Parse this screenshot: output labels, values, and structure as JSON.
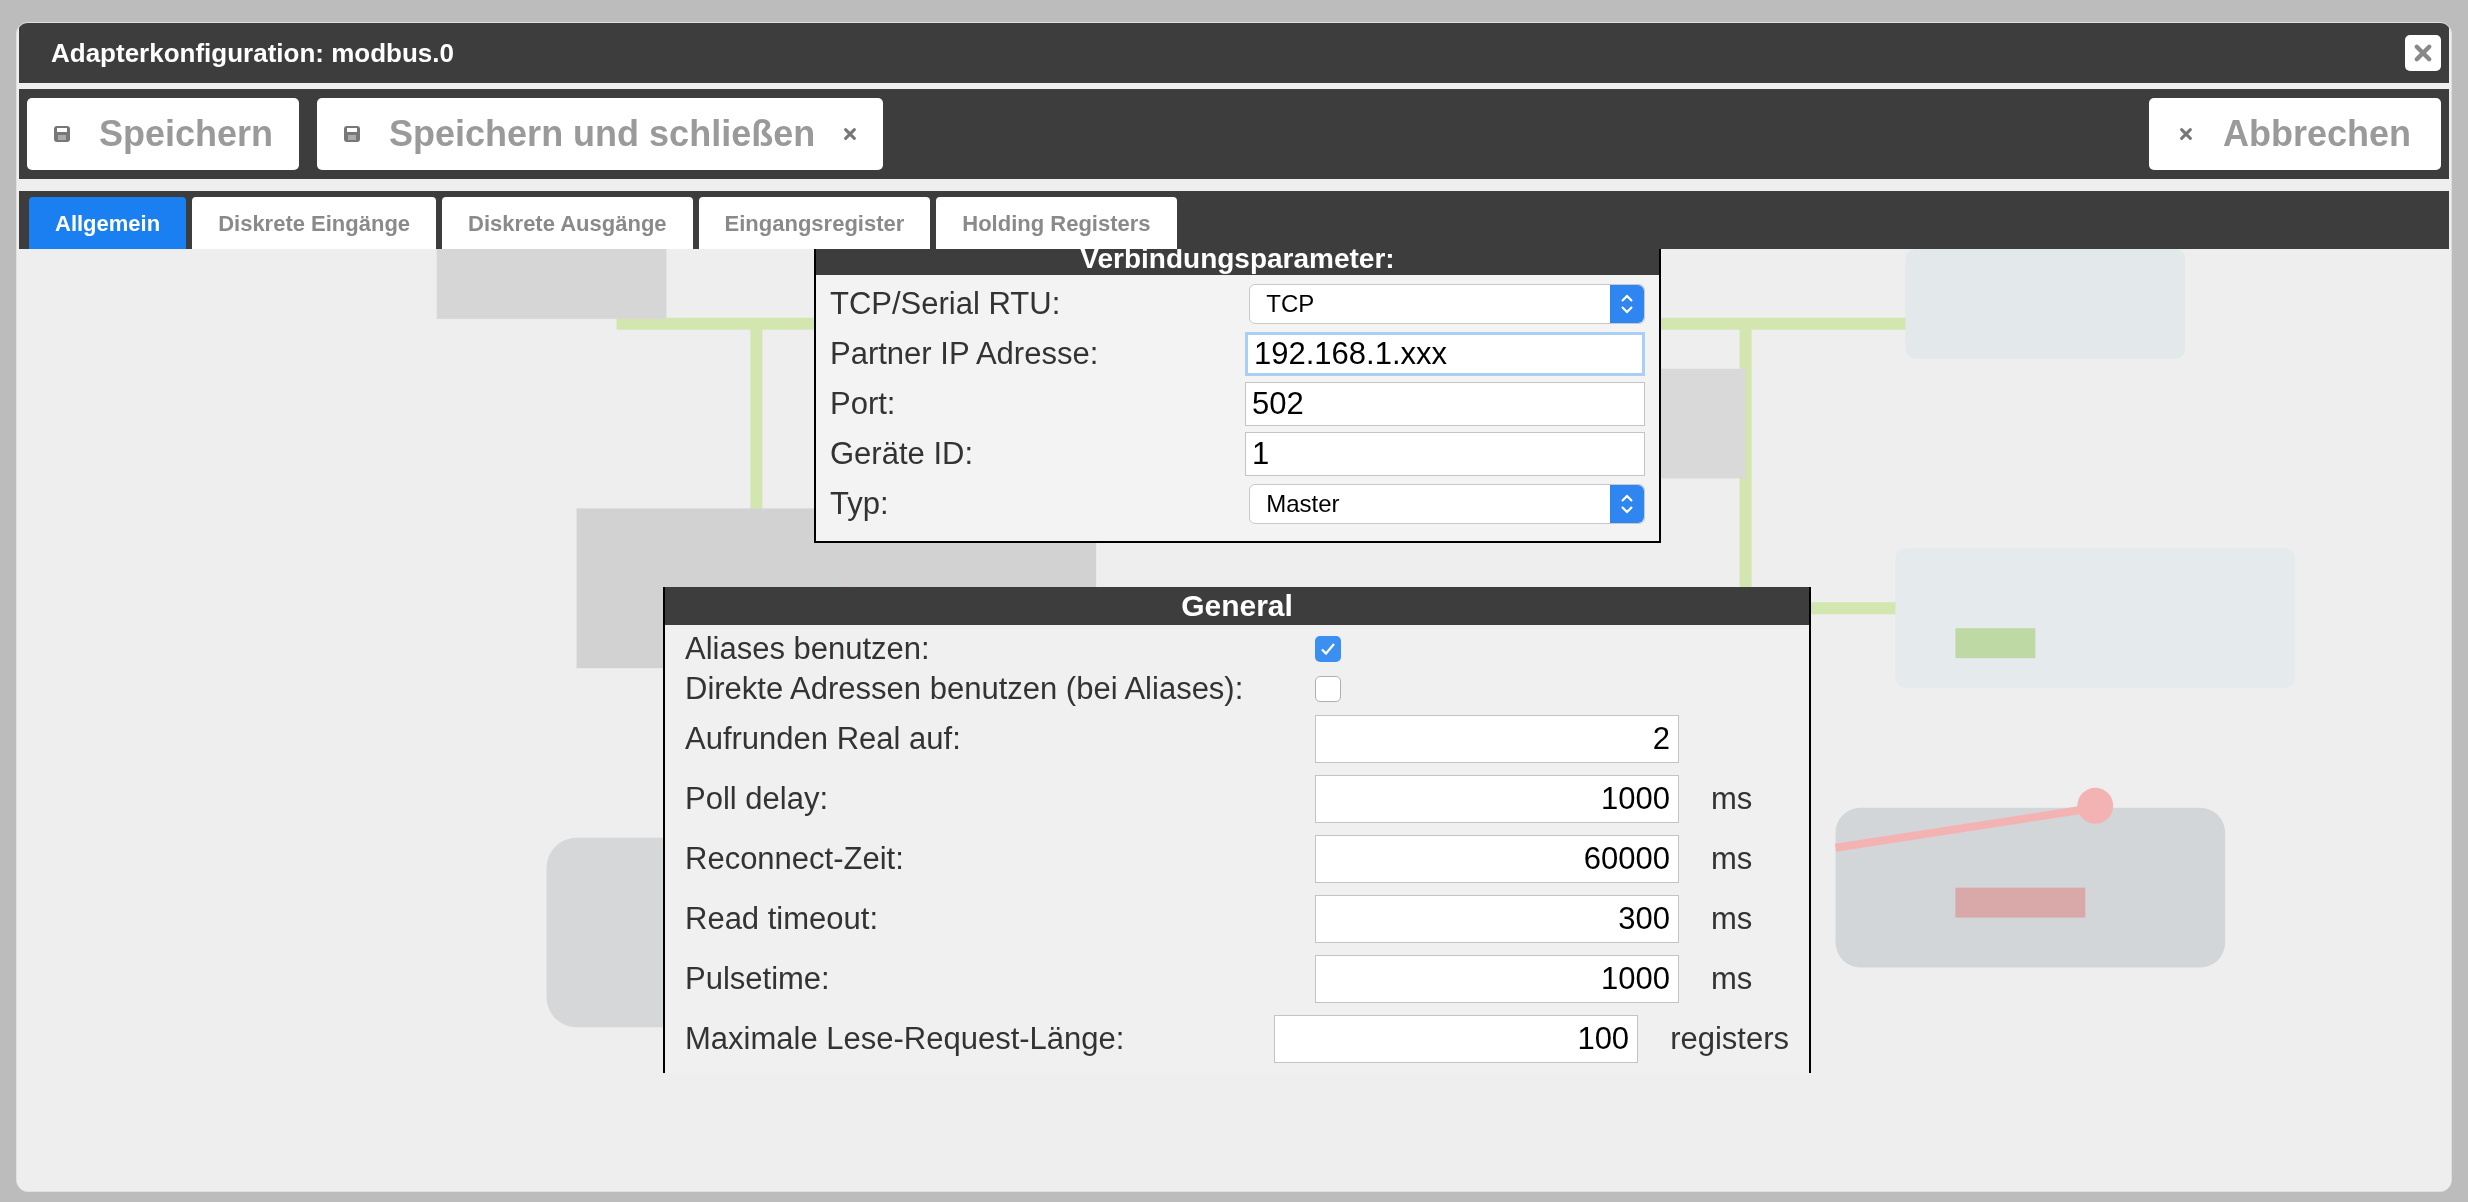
{
  "dialog": {
    "title": "Adapterkonfiguration: modbus.0"
  },
  "toolbar": {
    "buttons": [
      {
        "label": "Speichern",
        "kind": "save"
      },
      {
        "label": "Speichern und schließen",
        "kind": "save_close"
      }
    ],
    "cancel": {
      "label": "Abbrechen"
    }
  },
  "tabs": [
    {
      "label": "Allgemein",
      "selected": true
    },
    {
      "label": "Diskrete Eingänge",
      "selected": false
    },
    {
      "label": "Diskrete Ausgänge",
      "selected": false
    },
    {
      "label": "Eingangsregister",
      "selected": false
    },
    {
      "label": "Holding Registers",
      "selected": false
    }
  ],
  "connection": {
    "title": "Verbindungsparameter:",
    "rows": [
      {
        "label": "TCP/Serial RTU:",
        "kind": "select",
        "value": "TCP"
      },
      {
        "label": "Partner IP Adresse:",
        "kind": "input",
        "value": "192.168.1.xxx",
        "focused": true
      },
      {
        "label": "Port:",
        "kind": "input",
        "value": "502",
        "focused": false
      },
      {
        "label": "Geräte ID:",
        "kind": "input",
        "value": "1",
        "focused": false
      },
      {
        "label": "Typ:",
        "kind": "select",
        "value": "Master"
      }
    ]
  },
  "general": {
    "title": "General",
    "rows": [
      {
        "label": "Aliases benutzen:",
        "kind": "checkbox",
        "checked": true
      },
      {
        "label": "Direkte Adressen benutzen (bei Aliases):",
        "kind": "checkbox",
        "checked": false
      },
      {
        "label": "Aufrunden Real auf:",
        "kind": "number",
        "value": "2"
      },
      {
        "label": "Poll delay:",
        "kind": "number",
        "value": "1000",
        "unit": "ms"
      },
      {
        "label": "Reconnect-Zeit:",
        "kind": "number",
        "value": "60000",
        "unit": "ms"
      },
      {
        "label": "Read timeout:",
        "kind": "number",
        "value": "300",
        "unit": "ms"
      },
      {
        "label": "Pulsetime:",
        "kind": "number",
        "value": "1000",
        "unit": "ms"
      },
      {
        "label": "Maximale Lese-Request-Länge:",
        "kind": "number",
        "value": "100",
        "unit": "registers"
      }
    ]
  }
}
